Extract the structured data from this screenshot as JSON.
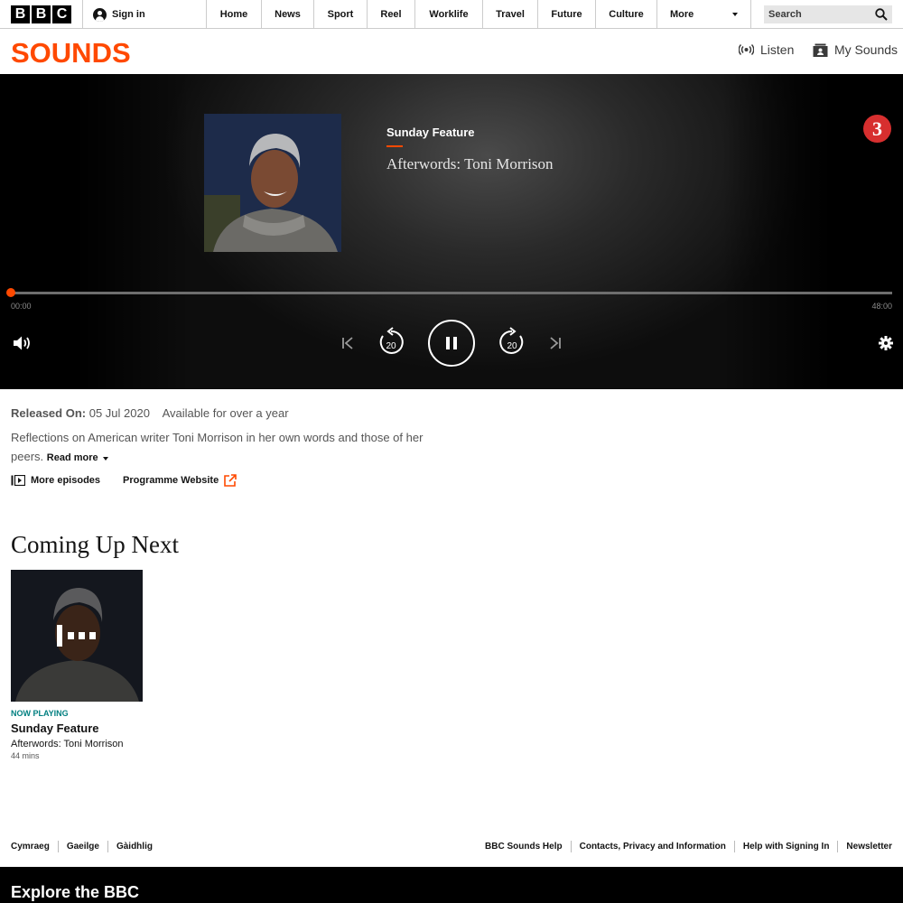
{
  "global_nav": {
    "logo_letters": [
      "B",
      "B",
      "C"
    ],
    "sign_in": "Sign in",
    "links": [
      "Home",
      "News",
      "Sport",
      "Reel",
      "Worklife",
      "Travel",
      "Future",
      "Culture"
    ],
    "more": "More",
    "search_placeholder": "Search"
  },
  "sounds_header": {
    "logo": "SOUNDS",
    "listen": "Listen",
    "my_sounds": "My Sounds"
  },
  "player": {
    "programme": "Sunday Feature",
    "episode": "Afterwords: Toni Morrison",
    "station_badge": "3",
    "elapsed": "00:00",
    "duration": "48:00",
    "progress_fraction": 0.0,
    "skip_back_seconds": "20",
    "skip_forward_seconds": "20",
    "state": "playing"
  },
  "details": {
    "released_label": "Released On:",
    "released_date": "05 Jul 2020",
    "availability": "Available for over a year",
    "synopsis": "Reflections on American writer Toni Morrison in her own words and those of her peers.",
    "read_more": "Read more",
    "more_episodes": "More episodes",
    "programme_website": "Programme Website"
  },
  "coming_up_next": {
    "heading": "Coming Up Next",
    "items": [
      {
        "status": "NOW PLAYING",
        "programme": "Sunday Feature",
        "episode": "Afterwords: Toni Morrison",
        "duration": "44 mins"
      }
    ]
  },
  "footer": {
    "left_links": [
      "Cymraeg",
      "Gaeilge",
      "Gàidhlig"
    ],
    "right_links": [
      "BBC Sounds Help",
      "Contacts, Privacy and Information",
      "Help with Signing In",
      "Newsletter"
    ],
    "explore": "Explore the BBC"
  },
  "colors": {
    "sounds_orange": "#ff4900",
    "now_playing_teal": "#007f80",
    "radio3_red": "#d72f2f"
  }
}
